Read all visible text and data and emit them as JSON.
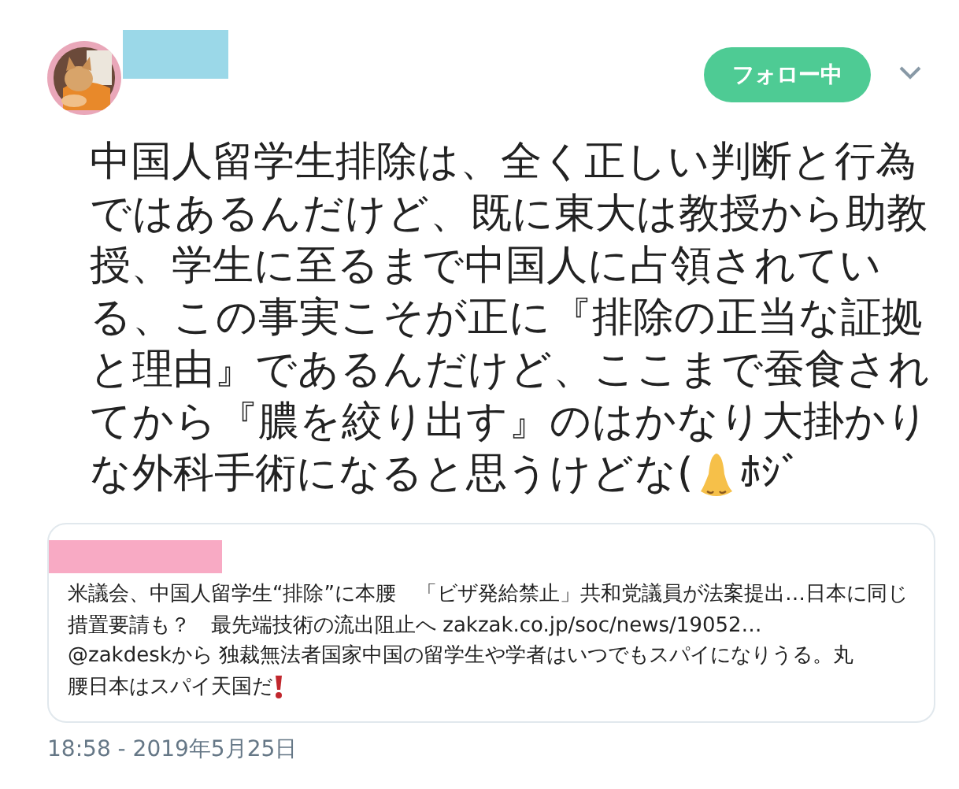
{
  "follow_button": {
    "label": "フォロー中"
  },
  "tweet": {
    "text": "中国人留学生排除は、全く正しい判断と行為ではあるんだけど、既に東大は教授から助教授、学生に至るまで中国人に占領されている、この事実こそが正に『排除の正当な証拠と理由』であるんだけど、ここまで蚕食されてから『膿を絞り出す』のはかなり大掛かり",
    "text_last_line": "な外科手術になると思うけどな(",
    "text_end": "ﾎｼﾞ"
  },
  "card": {
    "text": "米議会、中国人留学生“排除”に本腰　「ビザ発給禁止」共和党議員が法案提出…日本に同じ措置要請も？　最先端技術の流出阻止へ zakzak.co.jp/soc/news/19052…\n@zakdeskから 独裁無法者国家中国の留学生や学者はいつでもスパイになりうる。丸",
    "text_last_line": "腰日本はスパイ天国だ "
  },
  "timestamp": "18:58 - 2019年5月25日"
}
